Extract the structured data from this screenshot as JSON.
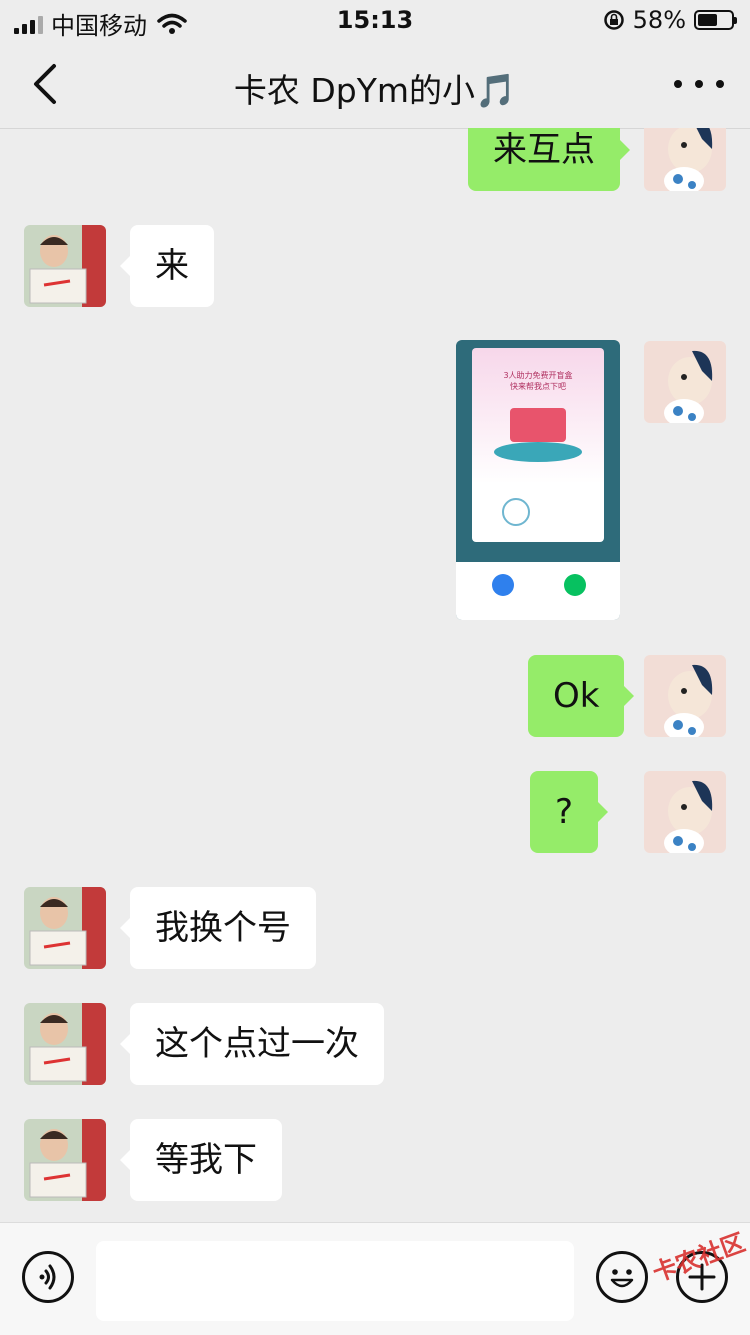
{
  "status_bar": {
    "carrier": "中国移动",
    "time": "15:13",
    "battery": "58%",
    "battery_level": 0.58,
    "icons": [
      "signal-icon",
      "wifi-icon",
      "rotation-lock-icon",
      "battery-icon"
    ]
  },
  "header": {
    "title": "卡农 DpYm的小🎵",
    "icons": [
      "back-chevron-icon",
      "more-dots-icon"
    ]
  },
  "messages": [
    {
      "side": "out",
      "text": "来互点"
    },
    {
      "side": "in",
      "text": "来"
    },
    {
      "side": "out",
      "type": "image",
      "text": "3人助力免费开盲盒\n快来帮我点下吧"
    },
    {
      "side": "out",
      "text": "Ok"
    },
    {
      "side": "out",
      "text": "?"
    },
    {
      "side": "in",
      "text": "我换个号"
    },
    {
      "side": "in",
      "text": "这个点过一次"
    },
    {
      "side": "in",
      "text": "等我下"
    }
  ],
  "input_bar": {
    "placeholder": "",
    "icons": [
      "voice-icon",
      "emoji-icon",
      "plus-icon"
    ]
  },
  "watermark": "卡农社区",
  "colors": {
    "background": "#ededed",
    "outgoing_bubble": "#95ec69",
    "incoming_bubble": "#ffffff"
  }
}
